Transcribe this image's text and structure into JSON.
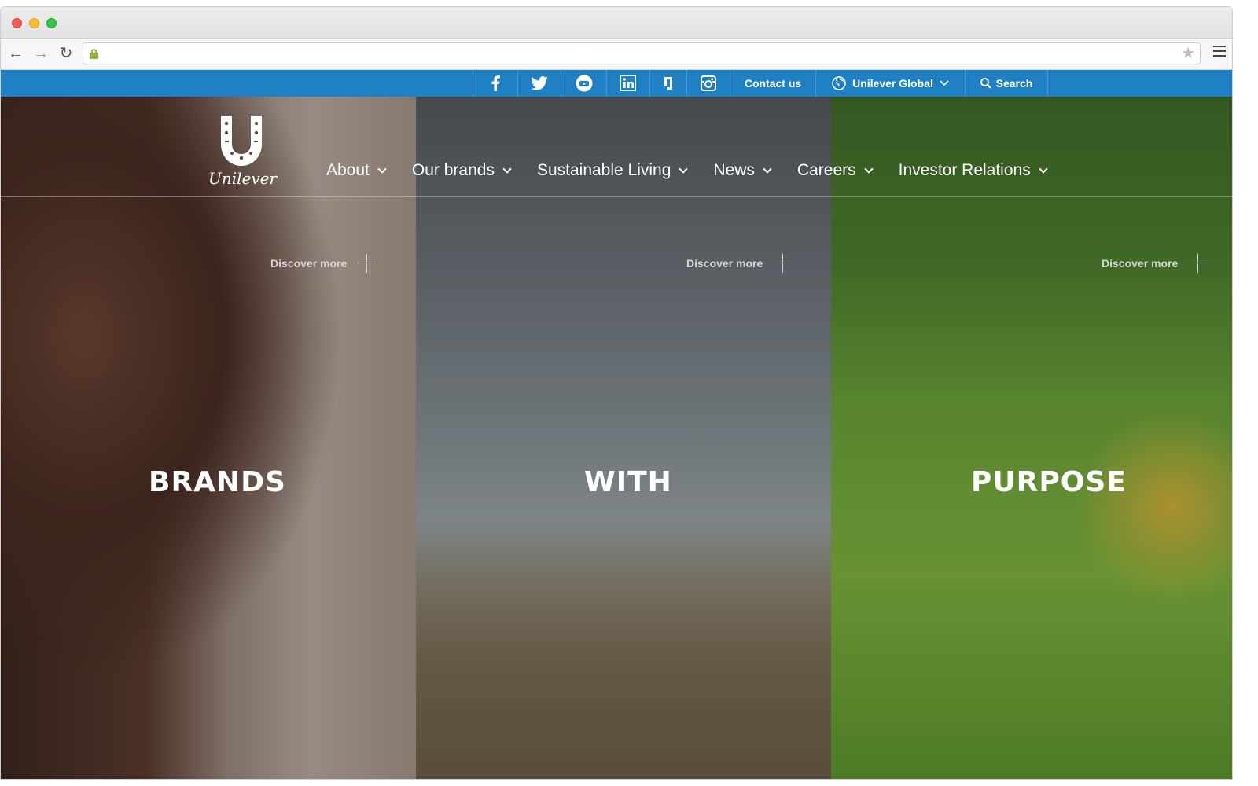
{
  "utility_bar": {
    "social": [
      {
        "name": "facebook"
      },
      {
        "name": "twitter"
      },
      {
        "name": "youtube"
      },
      {
        "name": "linkedin"
      },
      {
        "name": "g"
      },
      {
        "name": "instagram"
      }
    ],
    "contact_label": "Contact us",
    "region_label": "Unilever Global",
    "search_label": "Search",
    "color": "#1f80c4"
  },
  "header": {
    "logo_text": "Unilever",
    "nav": [
      {
        "label": "About"
      },
      {
        "label": "Our brands"
      },
      {
        "label": "Sustainable Living"
      },
      {
        "label": "News"
      },
      {
        "label": "Careers"
      },
      {
        "label": "Investor Relations"
      }
    ]
  },
  "hero": {
    "panels": [
      {
        "word": "BRANDS",
        "discover": "Discover more"
      },
      {
        "word": "WITH",
        "discover": "Discover more"
      },
      {
        "word": "PURPOSE",
        "discover": "Discover more"
      }
    ]
  }
}
